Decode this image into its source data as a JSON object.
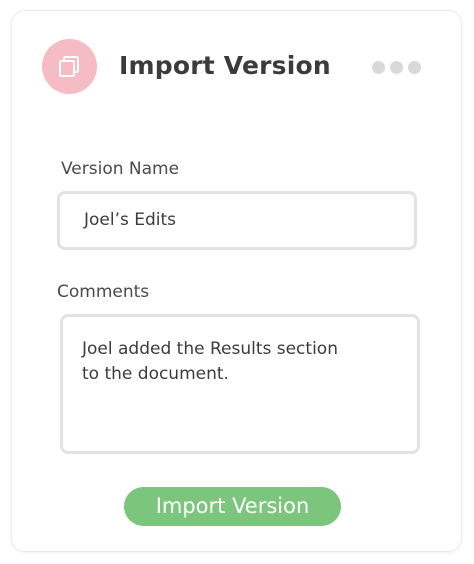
{
  "header": {
    "title": "Import Version",
    "app_icon": "copy-pages-icon",
    "menu_icon": "more-dots-icon"
  },
  "form": {
    "version_label": "Version Name",
    "version_value": "Joel’s Edits",
    "comments_label": "Comments",
    "comments_value": "Joel added the Results section\nto the document."
  },
  "actions": {
    "import_label": "Import Version"
  },
  "colors": {
    "icon_circle": "#f6bcc6",
    "button": "#7cc57d",
    "title_text": "#3b3b3b",
    "input_border": "#e2e2e2",
    "dots": "#d9d9d9"
  }
}
